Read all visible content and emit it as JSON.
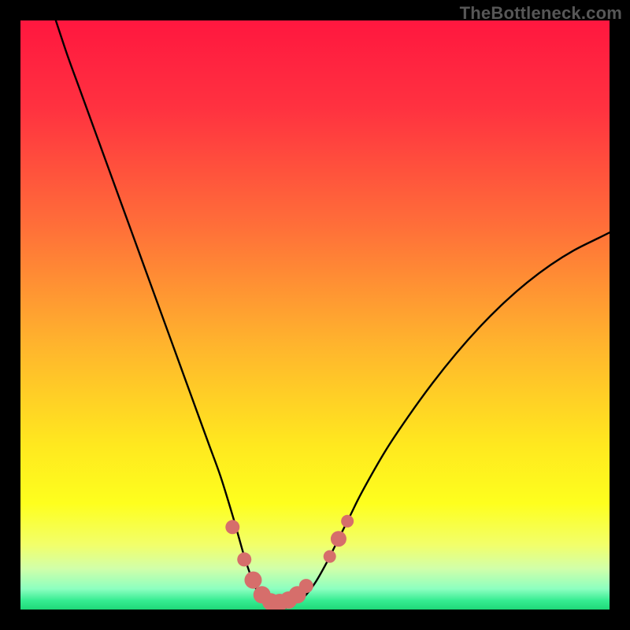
{
  "watermark": "TheBottleneck.com",
  "colors": {
    "frame": "#000000",
    "gradient_stops": [
      {
        "offset": 0.0,
        "color": "#ff173f"
      },
      {
        "offset": 0.15,
        "color": "#ff3240"
      },
      {
        "offset": 0.35,
        "color": "#ff6f39"
      },
      {
        "offset": 0.55,
        "color": "#ffb42d"
      },
      {
        "offset": 0.72,
        "color": "#ffe81f"
      },
      {
        "offset": 0.82,
        "color": "#feff1e"
      },
      {
        "offset": 0.89,
        "color": "#f2ff6a"
      },
      {
        "offset": 0.93,
        "color": "#d2ffa9"
      },
      {
        "offset": 0.965,
        "color": "#8cffc0"
      },
      {
        "offset": 0.985,
        "color": "#35ec91"
      },
      {
        "offset": 1.0,
        "color": "#1fd879"
      }
    ],
    "curve": "#000000",
    "markers": "#d66e6b"
  },
  "chart_data": {
    "type": "line",
    "title": "",
    "xlabel": "",
    "ylabel": "",
    "xlim": [
      0,
      100
    ],
    "ylim": [
      0,
      100
    ],
    "series": [
      {
        "name": "bottleneck-curve",
        "x": [
          6,
          8,
          10,
          12,
          14,
          16,
          18,
          20,
          22,
          24,
          26,
          28,
          30,
          32,
          34,
          36,
          37,
          38,
          39,
          40,
          41,
          42,
          43,
          44,
          45,
          46,
          48,
          50,
          52,
          54,
          56,
          58,
          62,
          66,
          70,
          74,
          78,
          82,
          86,
          90,
          94,
          98,
          100
        ],
        "y": [
          100,
          94,
          88.5,
          83,
          77.5,
          72,
          66.5,
          61,
          55.5,
          50,
          44.5,
          39,
          33.5,
          28,
          22.5,
          16,
          12.5,
          9,
          6,
          3.5,
          1.8,
          0.8,
          0.3,
          0.2,
          0.3,
          0.8,
          2,
          4.5,
          8,
          12,
          16,
          20,
          27,
          33,
          38.5,
          43.5,
          48,
          52,
          55.5,
          58.5,
          61,
          63,
          64
        ]
      }
    ],
    "markers": [
      {
        "x": 36.0,
        "y": 14.0,
        "r": 9
      },
      {
        "x": 38.0,
        "y": 8.5,
        "r": 9
      },
      {
        "x": 39.5,
        "y": 5.0,
        "r": 11
      },
      {
        "x": 41.0,
        "y": 2.5,
        "r": 11
      },
      {
        "x": 42.5,
        "y": 1.3,
        "r": 11
      },
      {
        "x": 44.0,
        "y": 1.2,
        "r": 11
      },
      {
        "x": 45.5,
        "y": 1.6,
        "r": 11
      },
      {
        "x": 47.0,
        "y": 2.5,
        "r": 11
      },
      {
        "x": 48.5,
        "y": 4.0,
        "r": 9
      },
      {
        "x": 52.5,
        "y": 9.0,
        "r": 8
      },
      {
        "x": 54.0,
        "y": 12.0,
        "r": 10
      },
      {
        "x": 55.5,
        "y": 15.0,
        "r": 8
      }
    ]
  }
}
